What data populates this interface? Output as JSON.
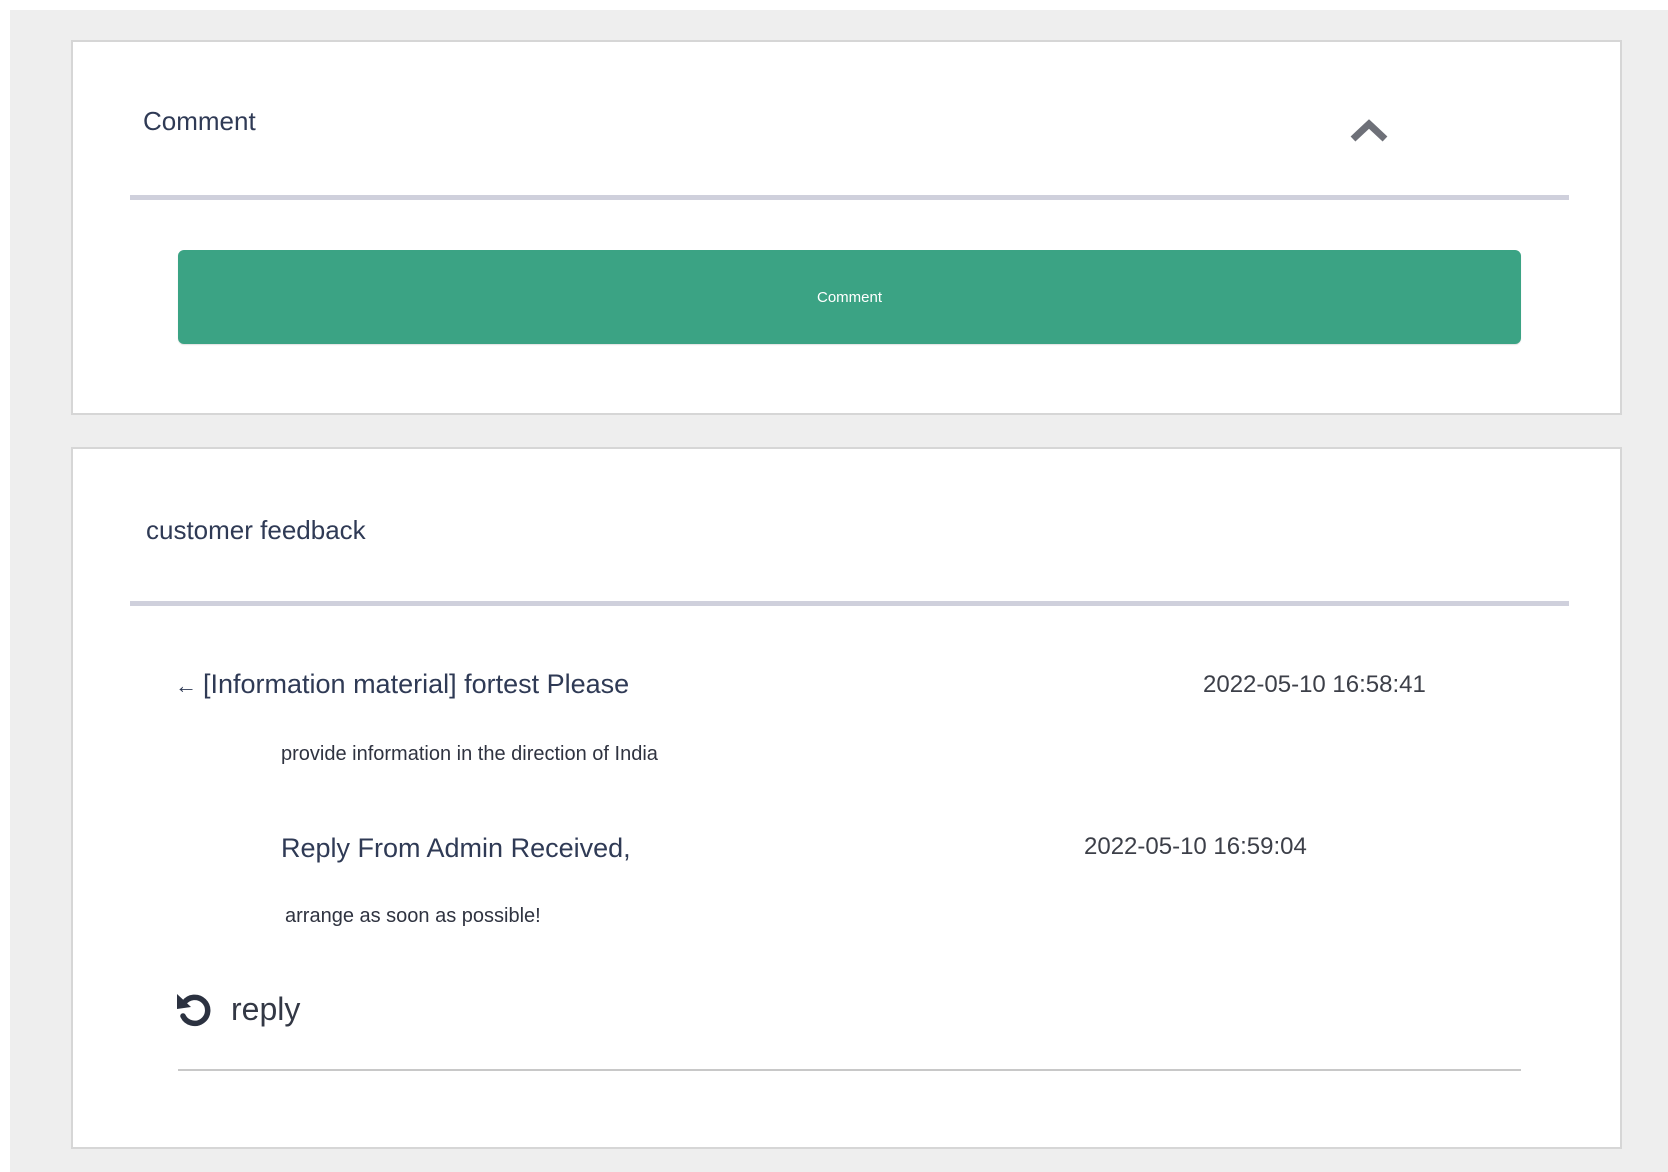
{
  "comment_panel": {
    "title": "Comment",
    "toggle_icon": "chevron-up-icon",
    "button_label": "Comment",
    "button_color": "#3ba384"
  },
  "feedback_panel": {
    "title": "customer feedback",
    "message": {
      "arrow": "←",
      "title": "[Information material] fortest Please",
      "time": "2022-05-10 16:58:41",
      "body": "provide information in the direction of India"
    },
    "reply": {
      "title": "Reply From Admin Received,",
      "time": "2022-05-10 16:59:04",
      "body": "arrange as soon as possible!"
    },
    "reply_action": {
      "icon": "undo-icon",
      "label": "reply"
    }
  }
}
